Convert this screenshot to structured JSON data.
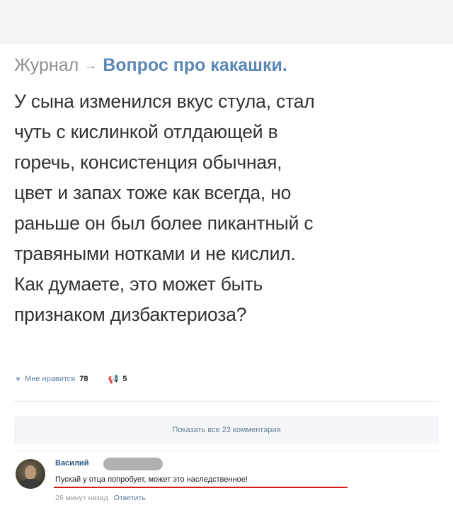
{
  "breadcrumb": {
    "section": "Журнал",
    "arrow": "→",
    "topic": "Вопрос про какашки."
  },
  "post": {
    "text": "У сына изменился вкус стула, стал\nчуть с кислинкой отлдающей в\nгоречь, консистенция обычная,\nцвет и запах тоже как всегда, но\nраньше он был более пикантный с\nтравяными нотками и не кислил.\nКак думаете, это может быть\nпризнаком дизбактериоза?"
  },
  "actions": {
    "like_label": "Мне нравится",
    "like_count": "78",
    "repost_count": "5"
  },
  "comments": {
    "show_all_label": "Показать все 23 комментария",
    "items": [
      {
        "author": "Василий",
        "text": "Пускай у отца попробует, может это наследственное!",
        "time": "26 минут назад",
        "reply_label": "Ответить"
      }
    ]
  },
  "colors": {
    "link": "#5d88b5",
    "highlight_underline": "#d11b1b"
  }
}
